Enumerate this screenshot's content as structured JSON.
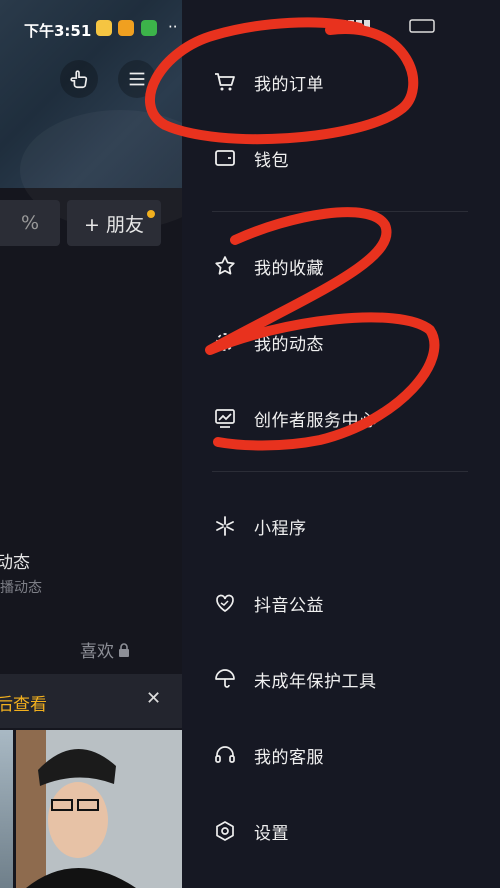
{
  "status_bar": {
    "time": "下午3:51"
  },
  "profile": {
    "percent_btn": "%",
    "add_friend": "+ 朋友",
    "dynamics_title": "动态",
    "dynamics_sub": "播动态",
    "likes": "喜欢",
    "banner_text": "后查看",
    "banner_close": "✕"
  },
  "drawer": {
    "items": [
      {
        "label": "我的订单",
        "icon": "cart-icon"
      },
      {
        "label": "钱包",
        "icon": "wallet-icon"
      },
      {
        "label": "我的收藏",
        "icon": "star-icon"
      },
      {
        "label": "我的动态",
        "icon": "dynamics-icon"
      },
      {
        "label": "创作者服务中心",
        "icon": "creator-icon"
      },
      {
        "label": "小程序",
        "icon": "mini-program-icon"
      },
      {
        "label": "抖音公益",
        "icon": "charity-heart-icon"
      },
      {
        "label": "未成年保护工具",
        "icon": "umbrella-icon"
      },
      {
        "label": "我的客服",
        "icon": "headset-icon"
      },
      {
        "label": "设置",
        "icon": "settings-icon"
      }
    ]
  },
  "colors": {
    "accent_yellow": "#f2b01e",
    "annotation_red": "#e8321e",
    "background": "#161823"
  }
}
